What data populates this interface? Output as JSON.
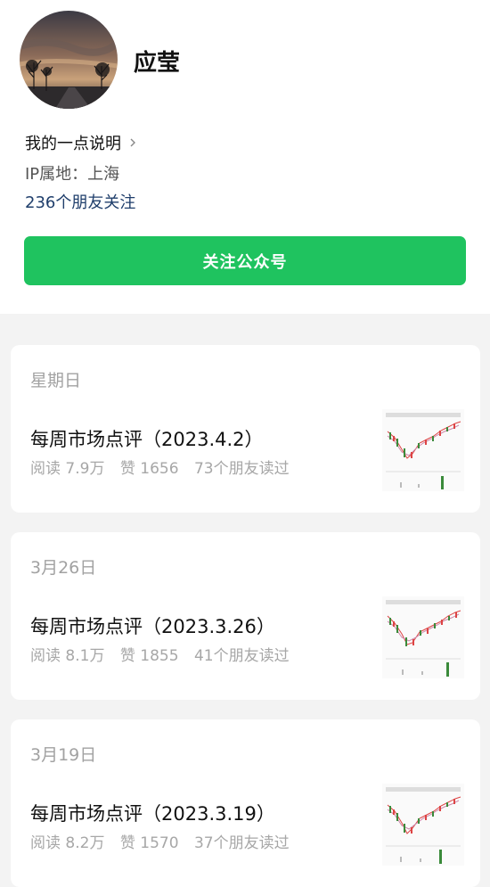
{
  "profile": {
    "name": "应莹",
    "description_link": "我的一点说明",
    "ip_location": "IP属地：上海",
    "friends_following": "236个朋友关注",
    "follow_button": "关注公众号"
  },
  "articles": [
    {
      "date": "星期日",
      "title": "每周市场点评（2023.4.2）",
      "reads": "阅读 7.9万",
      "likes": "赞 1656",
      "friends_read": "73个朋友读过",
      "thumbnail_icon": "stock-chart-thumbnail"
    },
    {
      "date": "3月26日",
      "title": "每周市场点评（2023.3.26）",
      "reads": "阅读 8.1万",
      "likes": "赞 1855",
      "friends_read": "41个朋友读过",
      "thumbnail_icon": "stock-chart-thumbnail"
    },
    {
      "date": "3月19日",
      "title": "每周市场点评（2023.3.19）",
      "reads": "阅读 8.2万",
      "likes": "赞 1570",
      "friends_read": "37个朋友读过",
      "thumbnail_icon": "stock-chart-thumbnail"
    }
  ],
  "colors": {
    "accent_green": "#1fc35f",
    "friends_link": "#1f3e6b",
    "muted_text": "#a7a7a7",
    "background": "#f3f3f3"
  }
}
